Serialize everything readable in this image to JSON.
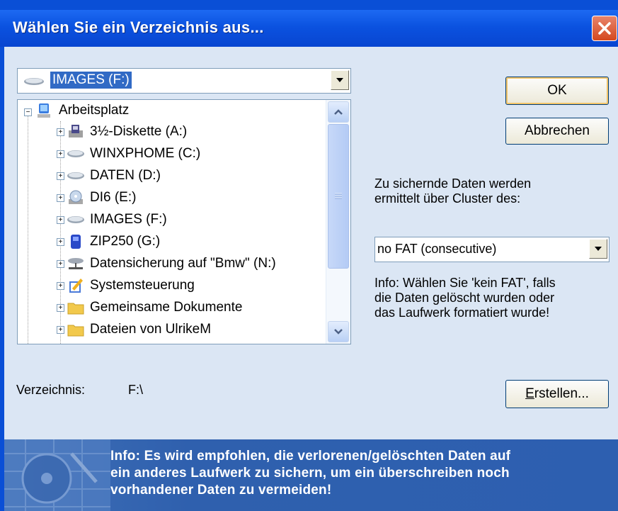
{
  "window": {
    "title": "Wählen Sie ein Verzeichnis aus..."
  },
  "drive_combo": {
    "selected": "IMAGES (F:)",
    "icon": "drive-icon"
  },
  "tree": {
    "root": {
      "label": "Arbeitsplatz",
      "icon": "my-computer-icon"
    },
    "items": [
      {
        "label": "3½-Diskette (A:)",
        "icon": "floppy-icon"
      },
      {
        "label": "WINXPHOME (C:)",
        "icon": "drive-icon"
      },
      {
        "label": "DATEN (D:)",
        "icon": "drive-icon"
      },
      {
        "label": "DI6 (E:)",
        "icon": "cd-drive-icon"
      },
      {
        "label": "IMAGES (F:)",
        "icon": "drive-icon"
      },
      {
        "label": "ZIP250 (G:)",
        "icon": "zip-drive-icon"
      },
      {
        "label": "Datensicherung auf \"Bmw\" (N:)",
        "icon": "network-drive-icon"
      },
      {
        "label": "Systemsteuerung",
        "icon": "control-panel-icon"
      },
      {
        "label": "Gemeinsame Dokumente",
        "icon": "folder-icon"
      },
      {
        "label": "Dateien von UlrikeM",
        "icon": "folder-icon"
      }
    ]
  },
  "buttons": {
    "ok": "OK",
    "cancel": "Abbrechen",
    "create_accel": "E",
    "create_rest": "rstellen..."
  },
  "cluster_label_line1": "Zu sichernde Daten werden",
  "cluster_label_line2": "ermittelt über Cluster des:",
  "fat_select": {
    "selected": "no FAT (consecutive)"
  },
  "info_line1": "Info: Wählen Sie 'kein FAT', falls",
  "info_line2": "die Daten gelöscht wurden oder",
  "info_line3": "das Laufwerk formatiert wurde!",
  "directory": {
    "label": "Verzeichnis:",
    "value": "F:\\"
  },
  "banner": {
    "line1": "Info: Es wird empfohlen, die verlorenen/gelöschten Daten auf",
    "line2": "ein anderes Laufwerk zu sichern, um ein überschreiben noch",
    "line3": "vorhandener Daten zu vermeiden!"
  },
  "colors": {
    "titlebar": "#0b52e0",
    "selection": "#316ac5",
    "banner": "#2f60ae",
    "close": "#d4481f"
  }
}
